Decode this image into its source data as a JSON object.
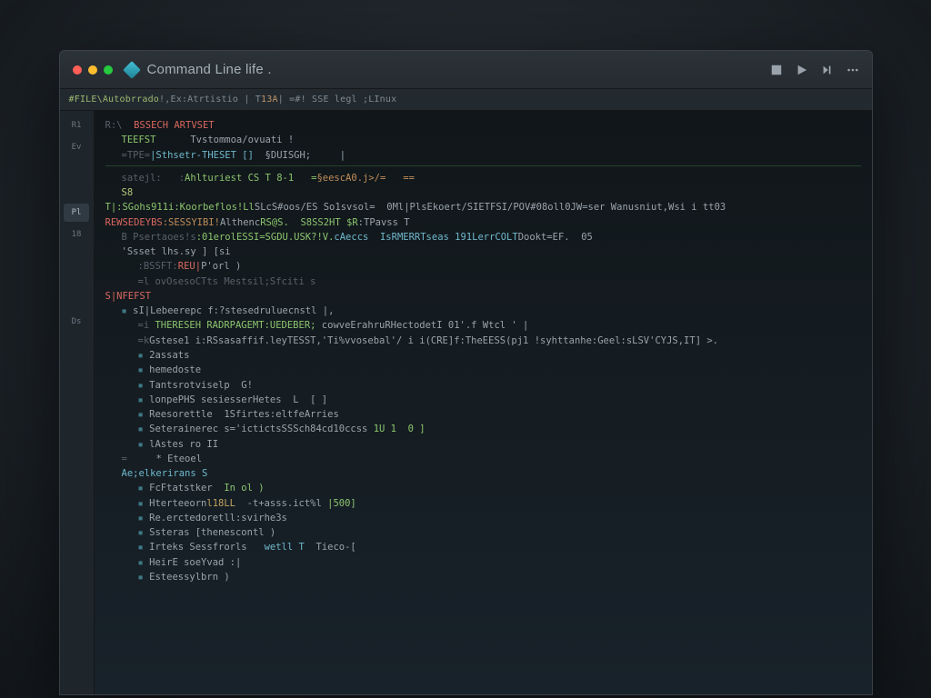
{
  "window": {
    "title": "Command Line life ."
  },
  "titlebar_icons": {
    "stop": "stop-icon",
    "play": "play-icon",
    "step": "step-icon",
    "more": "more-icon"
  },
  "infobar": {
    "text_prefix": "#FILE\\Autobrrado ",
    "text_mid": "!,Ex:Atrtistio | T ",
    "num": "13A",
    "text_tail": " | =#! SSE legl ;LInux"
  },
  "gutter": {
    "items": [
      "R1",
      "Ev",
      "",
      "",
      "Pl",
      "18",
      "",
      "",
      "",
      "Ds"
    ]
  },
  "lines": [
    {
      "cls": "",
      "segs": [
        {
          "t": "R:\\  ",
          "c": "c-dim"
        },
        {
          "t": "BSSECH ARTVSET",
          "c": "c-err"
        }
      ]
    },
    {
      "cls": "indent1",
      "segs": [
        {
          "t": "TEEFST      ",
          "c": "c-kw"
        },
        {
          "t": "Tvstommoa/ovuati !",
          "c": "c-op"
        }
      ]
    },
    {
      "cls": "indent1",
      "segs": [
        {
          "t": "=TPE=",
          "c": "c-dim"
        },
        {
          "t": "|Sthsetr-THESET []  ",
          "c": "c-ty"
        },
        {
          "t": "§DUISGH;     |",
          "c": "c-op"
        }
      ]
    },
    {
      "cls": "hr-line",
      "segs": []
    },
    {
      "cls": "indent1",
      "segs": [
        {
          "t": "satejl:   :",
          "c": "c-dim"
        },
        {
          "t": "Ahlturiest CS T 8-1   =",
          "c": "c-kw"
        },
        {
          "t": "§eescA0.j>/=   ==",
          "c": "c-str"
        }
      ]
    },
    {
      "cls": "indent1",
      "segs": [
        {
          "t": "S8",
          "c": "c-hi"
        }
      ]
    },
    {
      "cls": "",
      "segs": [
        {
          "t": "T|:SGohs911i:Koorbeflos!Ll",
          "c": "c-kw"
        },
        {
          "t": "SLcS#oos/ES So1svsol=  0Ml|PlsEkoert/SIETFSI/POV#08oll0JW=ser Wanusniut,Wsi i tt03",
          "c": "c-op"
        }
      ]
    },
    {
      "cls": "",
      "segs": [
        {
          "t": "REWSEDEYBS",
          "c": "c-err"
        },
        {
          "t": ":SESSYIBI!",
          "c": "c-str"
        },
        {
          "t": "Althenc",
          "c": "c-op"
        },
        {
          "t": "RS@S.  S8SS2HT $R",
          "c": "c-kw"
        },
        {
          "t": ":TPavss T",
          "c": "c-op"
        }
      ]
    },
    {
      "cls": "indent1",
      "segs": [
        {
          "t": "B Psertaoes!s",
          "c": "c-dim"
        },
        {
          "t": ":01erolESSI=SGDU.USK?!V.",
          "c": "c-kw"
        },
        {
          "t": "cAeccs  IsRMERRTseas 191LerrCOLT",
          "c": "c-ty"
        },
        {
          "t": "Dookt=EF.  05",
          "c": "c-op"
        }
      ]
    },
    {
      "cls": "indent1",
      "segs": [
        {
          "t": "'Ssset lhs.sy ] [si",
          "c": "c-op"
        }
      ]
    },
    {
      "cls": "indent2",
      "segs": [
        {
          "t": ":BSSFT:",
          "c": "c-dim"
        },
        {
          "t": "REU|",
          "c": "c-err"
        },
        {
          "t": "P'orl )",
          "c": "c-op"
        }
      ]
    },
    {
      "cls": "indent2",
      "segs": [
        {
          "t": "=l ovOsesoCTts Mestsil;Sfciti s",
          "c": "c-dim"
        }
      ]
    },
    {
      "cls": "",
      "segs": [
        {
          "t": "S|NFEFST",
          "c": "c-err"
        }
      ]
    },
    {
      "cls": "indent1 bullet",
      "segs": [
        {
          "t": "sI|Lebeerepc f:?stesedruluecnstl |,",
          "c": "c-op"
        }
      ]
    },
    {
      "cls": "indent2",
      "segs": [
        {
          "t": "=i ",
          "c": "c-dim"
        },
        {
          "t": "THERESEH RADRPAGEMT:UEDEBER; ",
          "c": "c-kw"
        },
        {
          "t": "cowveErahruRHectodetI 01'.f Wtcl ' |",
          "c": "c-op"
        }
      ]
    },
    {
      "cls": "indent2",
      "segs": [
        {
          "t": "=k",
          "c": "c-dim"
        },
        {
          "t": "Gstese1 i:RSsasaffif.leyTESST,'Ti%vvosebal'/ i i(CRE]f:TheEESS(pj1 !syhttanhe:Geel:sLSV'CYJS,IT] >.",
          "c": "c-op"
        }
      ]
    },
    {
      "cls": "indent2 bullet",
      "segs": [
        {
          "t": "2assats",
          "c": "c-op"
        }
      ]
    },
    {
      "cls": "indent2 bullet",
      "segs": [
        {
          "t": "hemedoste",
          "c": "c-op"
        }
      ]
    },
    {
      "cls": "indent2 bullet",
      "segs": [
        {
          "t": "Tantsrotviselp  G!",
          "c": "c-op"
        }
      ]
    },
    {
      "cls": "indent2 bullet",
      "segs": [
        {
          "t": "lonpePHS sesiesserHetes  L  [ ]",
          "c": "c-op"
        }
      ]
    },
    {
      "cls": "indent2 bullet",
      "segs": [
        {
          "t": "Reesorettle  1Sfirtes:eltfeArries",
          "c": "c-op"
        }
      ]
    },
    {
      "cls": "indent2 bullet",
      "segs": [
        {
          "t": "Seterainerec s='ictictsSSSch84cd10ccss ",
          "c": "c-op"
        },
        {
          "t": "1U 1  0 ]",
          "c": "c-kw"
        }
      ]
    },
    {
      "cls": "indent2 bullet",
      "segs": [
        {
          "t": "lAstes ro II",
          "c": "c-op"
        }
      ]
    },
    {
      "cls": "indent1",
      "segs": [
        {
          "t": "=     ",
          "c": "c-dim"
        },
        {
          "t": "* Eteoel",
          "c": "c-op"
        }
      ]
    },
    {
      "cls": "indent1",
      "segs": [
        {
          "t": "Ae;elkerirans S",
          "c": "c-ty"
        }
      ]
    },
    {
      "cls": "indent2 bullet",
      "segs": [
        {
          "t": "FcFtatstker  ",
          "c": "c-op"
        },
        {
          "t": "In ol )",
          "c": "c-kw"
        }
      ]
    },
    {
      "cls": "indent2 bullet",
      "segs": [
        {
          "t": "Hterteeorn",
          "c": "c-op"
        },
        {
          "t": "l18LL",
          "c": "c-num"
        },
        {
          "t": "  -t+asss.ict%l ",
          "c": "c-op"
        },
        {
          "t": "|500]",
          "c": "c-kw"
        }
      ]
    },
    {
      "cls": "indent2 bullet",
      "segs": [
        {
          "t": "Re.erctedoretll:svirhe3s",
          "c": "c-op"
        }
      ]
    },
    {
      "cls": "indent2 bullet",
      "segs": [
        {
          "t": "Ssteras [thenescontl )",
          "c": "c-op"
        }
      ]
    },
    {
      "cls": "indent2 bullet",
      "segs": [
        {
          "t": "Irteks Sessfrorls   ",
          "c": "c-op"
        },
        {
          "t": "wetll T",
          "c": "c-ty"
        },
        {
          "t": "  Tieco-[",
          "c": "c-op"
        }
      ]
    },
    {
      "cls": "indent2 bullet",
      "segs": [
        {
          "t": "HeirE soeYvad :|",
          "c": "c-op"
        }
      ]
    },
    {
      "cls": "indent2 bullet",
      "segs": [
        {
          "t": "Esteessylbrn )",
          "c": "c-op"
        }
      ]
    }
  ]
}
